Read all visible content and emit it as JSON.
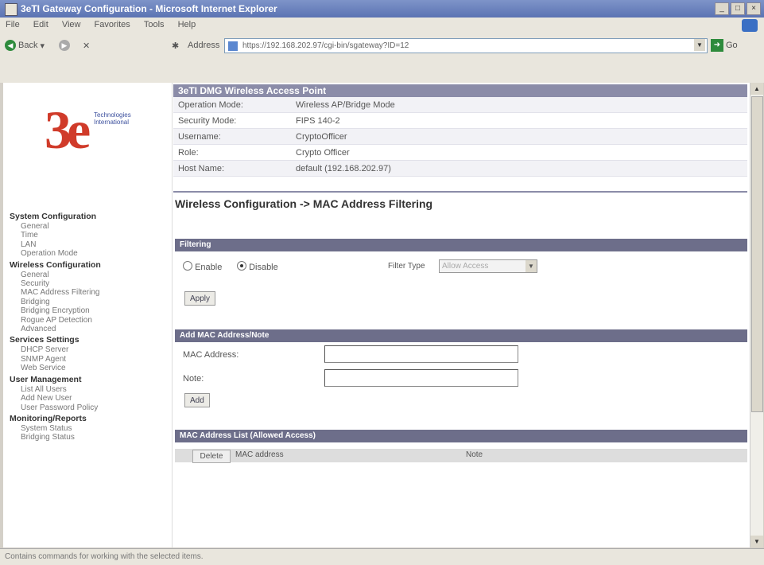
{
  "window": {
    "title": "3eTI Gateway Configuration - Microsoft Internet Explorer",
    "controls": [
      "_",
      "□",
      "×"
    ]
  },
  "menu": [
    "File",
    "Edit",
    "View",
    "Favorites",
    "Tools",
    "Help"
  ],
  "toolbar": {
    "back_label": "Back",
    "address_label": "Address",
    "url": "https://192.168.202.97/cgi-bin/sgateway?ID=12",
    "go_label": "Go"
  },
  "logo": {
    "mark": "3e",
    "tagline_line1": "Technologies",
    "tagline_line2": "International"
  },
  "sidebar": {
    "sections": [
      {
        "label": "System Configuration",
        "items": [
          "General",
          "Time",
          "LAN",
          "Operation Mode"
        ]
      },
      {
        "label": "Wireless Configuration",
        "items": [
          "General",
          "Security",
          "MAC Address Filtering",
          "Bridging",
          "Bridging Encryption",
          "Rogue AP Detection",
          "Advanced"
        ]
      },
      {
        "label": "Services Settings",
        "items": [
          "DHCP Server",
          "SNMP Agent",
          "Web Service"
        ]
      },
      {
        "label": "User Management",
        "items": [
          "List All Users",
          "Add New User",
          "User Password Policy"
        ]
      },
      {
        "label": "Monitoring/Reports",
        "items": [
          "System Status",
          "Bridging Status"
        ]
      }
    ]
  },
  "header": {
    "title": "3eTI DMG Wireless Access Point",
    "info": [
      {
        "key": "Operation Mode:",
        "value": "Wireless AP/Bridge Mode"
      },
      {
        "key": "Security Mode:",
        "value": "FIPS 140-2"
      },
      {
        "key": "Username:",
        "value": "CryptoOfficer"
      },
      {
        "key": "Role:",
        "value": "Crypto Officer"
      },
      {
        "key": "Host Name:",
        "value": "default (192.168.202.97)"
      }
    ]
  },
  "page_title": "Wireless Configuration -> MAC Address Filtering",
  "filtering": {
    "section_label": "Filtering",
    "enable_label": "Enable",
    "disable_label": "Disable",
    "selected": "Disable",
    "filter_type_label": "Filter Type",
    "filter_type_value": "Allow Access",
    "apply_label": "Apply"
  },
  "add_mac": {
    "section_label": "Add MAC Address/Note",
    "mac_label": "MAC Address:",
    "mac_value": "",
    "note_label": "Note:",
    "note_value": "",
    "add_label": "Add"
  },
  "mac_list": {
    "section_label": "MAC Address List (Allowed Access)",
    "columns": [
      "Delete",
      "MAC address",
      "Note"
    ]
  },
  "status_bar": "Contains commands for working with the selected items."
}
